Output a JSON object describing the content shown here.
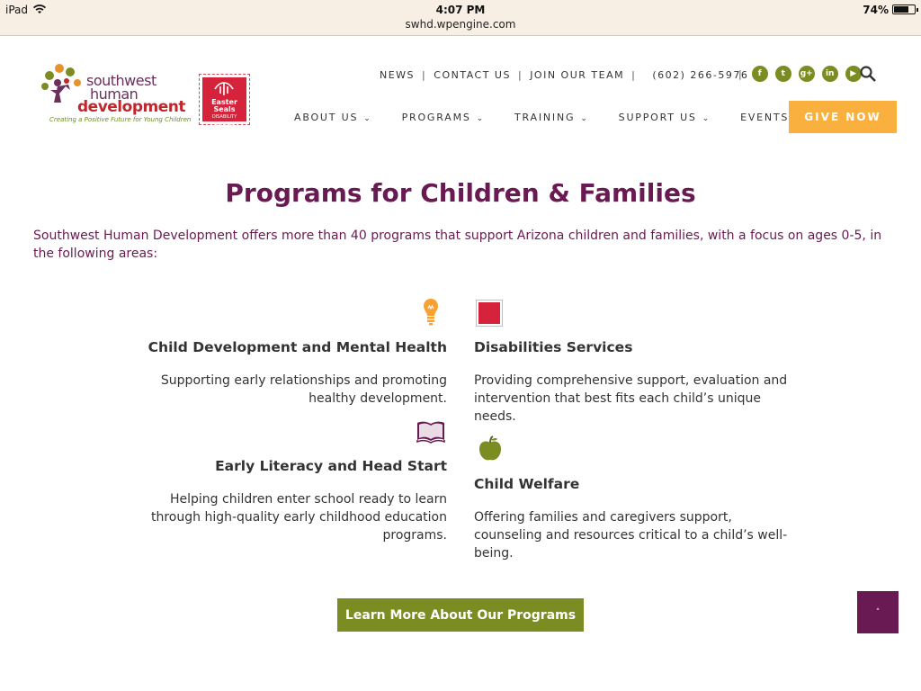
{
  "status_bar": {
    "device": "iPad",
    "time": "4:07 PM",
    "url": "swhd.wpengine.com",
    "battery": "74%",
    "battery_level": 0.74
  },
  "logo": {
    "line1": "southwest",
    "line2": "human",
    "line3": "development",
    "tagline": "Creating a Positive Future for Young Children",
    "partner_text": "Easter Seals",
    "partner_sub": "DISABILITY SERVICES"
  },
  "top_nav": {
    "news": "NEWS",
    "contact": "CONTACT US",
    "join": "JOIN OUR TEAM",
    "phone": "(602) 266-5976",
    "separator": "|"
  },
  "social": [
    "f",
    "t",
    "g+",
    "in",
    "▶"
  ],
  "main_nav": {
    "about": "ABOUT US",
    "programs": "PROGRAMS",
    "training": "TRAINING",
    "support": "SUPPORT US",
    "events": "EVENTS",
    "give": "GIVE NOW"
  },
  "page": {
    "title": "Programs for Children & Families",
    "intro": "Southwest Human Development offers more than 40 programs that support Arizona children and families, with a focus on ages 0-5, in the following areas:"
  },
  "programs": {
    "p1": {
      "icon": "lightbulb-icon",
      "title": "Child Development and Mental Health",
      "desc": "Supporting early relationships and promoting healthy development."
    },
    "p2": {
      "icon": "book-icon",
      "title": "Early Literacy and Head Start",
      "desc": "Helping children enter school ready to learn through high-quality early childhood education programs."
    },
    "p3": {
      "icon": "easter-seals-icon",
      "title": "Disabilities Services",
      "desc": "Providing comprehensive support, evaluation and intervention that best fits each child’s unique needs."
    },
    "p4": {
      "icon": "apple-icon",
      "title": "Child Welfare",
      "desc": "Offering families and caregivers support, counseling and resources critical to a child’s well-being."
    }
  },
  "cta": {
    "learn_more": "Learn More About Our Programs"
  },
  "colors": {
    "purple": "#6a1a52",
    "green": "#7b8c23",
    "orange": "#f9b03e"
  }
}
